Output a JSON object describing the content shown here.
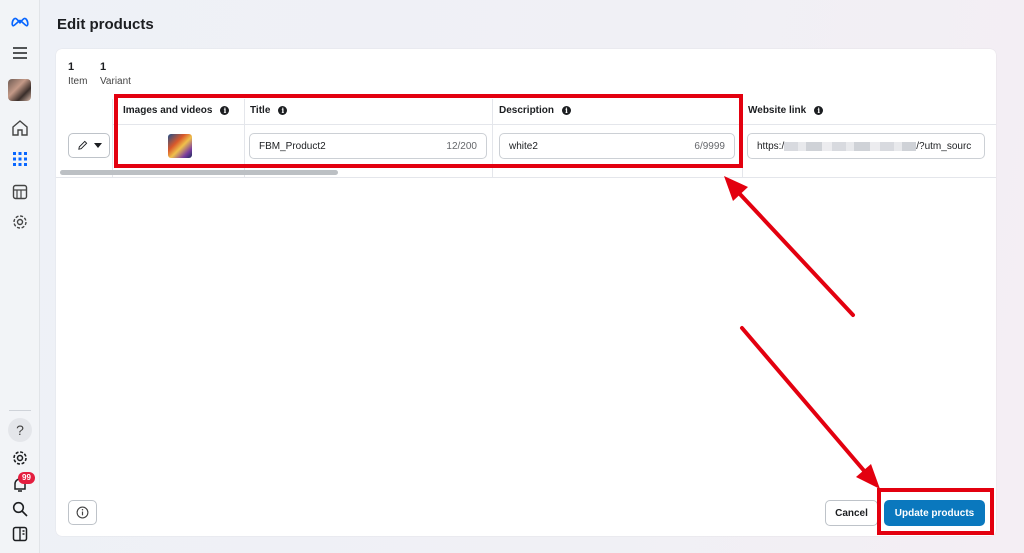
{
  "page": {
    "title": "Edit products"
  },
  "stats": [
    {
      "number": "1",
      "label": "Item"
    },
    {
      "number": "1",
      "label": "Variant"
    }
  ],
  "columns": {
    "images": "Images and videos",
    "title": "Title",
    "description": "Description",
    "website": "Website link"
  },
  "row": {
    "title_value": "FBM_Product2",
    "title_count": "12/200",
    "description_value": "white2",
    "description_count": "6/9999",
    "website_prefix": "https:/",
    "website_suffix": "/?utm_sourc"
  },
  "sidebar": {
    "help_label": "?",
    "notification_count": "99",
    "icons": [
      "meta-logo-icon",
      "menu-icon",
      "avatar",
      "home-icon",
      "apps-grid-icon",
      "storefront-icon",
      "settings-icon",
      "help-icon",
      "gear-icon",
      "bell-icon",
      "search-icon",
      "panel-icon"
    ]
  },
  "actions": {
    "cancel": "Cancel",
    "update": "Update products"
  },
  "colors": {
    "primary_button": "#0a78be",
    "annotation": "#e3000f",
    "badge": "#e41e3f"
  }
}
